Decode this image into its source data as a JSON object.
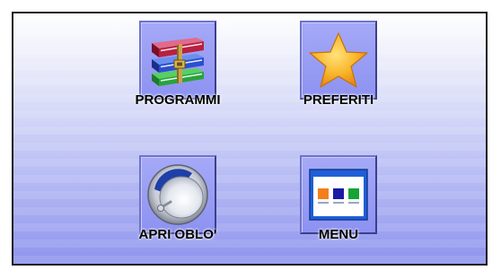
{
  "tiles": {
    "programmi": {
      "label": "PROGRAMMI",
      "icon": "books-icon"
    },
    "preferiti": {
      "label": "PREFERITI",
      "icon": "star-icon"
    },
    "apri_oblo": {
      "label": "APRI OBLO'",
      "icon": "door-porthole-icon"
    },
    "menu": {
      "label": "MENU",
      "icon": "menu-window-icon"
    }
  },
  "colors": {
    "background_top": "#ffffff",
    "background_bottom": "#8f94ee",
    "tile_fill": "#9a9ff4",
    "border": "#1b1b1b",
    "star": "#f7a21b",
    "menu_window_header": "#1f5ed8",
    "menu_square_1": "#f47f1c",
    "menu_square_2": "#1a1aa6",
    "menu_square_3": "#15a335"
  }
}
